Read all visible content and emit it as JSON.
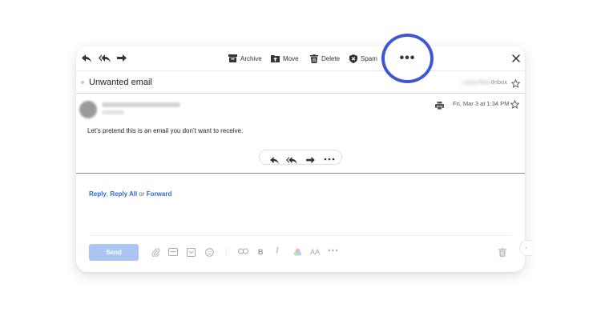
{
  "toolbar": {
    "reply_icon": "reply-icon",
    "reply_all_icon": "reply-all-icon",
    "forward_icon": "forward-icon",
    "archive_label": "Archive",
    "move_label": "Move",
    "delete_label": "Delete",
    "spam_label": "Spam",
    "more_icon": "more-dots-icon",
    "close_icon": "close-icon"
  },
  "subject_row": {
    "subject": "Unwanted email",
    "folder_prefix": "Laura Rico",
    "folder": "/Inbox"
  },
  "message": {
    "date": "Fri, Mar 3 at 1:34 PM",
    "body": "Let’s pretend this is an email you don’t want to receive."
  },
  "reply_line": {
    "reply": "Reply",
    "reply_all": "Reply All",
    "or": "or",
    "forward": "Forward"
  },
  "compose": {
    "send_label": "Send",
    "bold_label": "B",
    "italic_label": "I",
    "font_size_label": "AA"
  },
  "highlight": {
    "dots": "•••",
    "ring_color": "#3f57d6"
  },
  "colors": {
    "link": "#2a6ad8",
    "send_button": "#aac4f3"
  }
}
